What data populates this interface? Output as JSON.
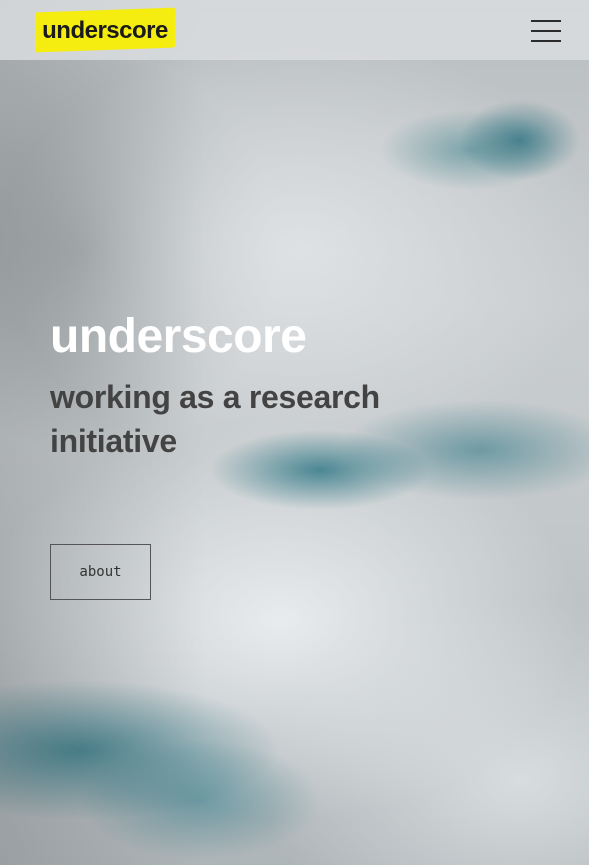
{
  "header": {
    "logo_text": "underscore",
    "logo_color": "#f5ec10",
    "menu_icon": "hamburger-menu-icon"
  },
  "hero": {
    "title": "underscore",
    "subtitle": "working as a research initiative",
    "about_label": "about",
    "background": "cloudy-sky-image"
  }
}
